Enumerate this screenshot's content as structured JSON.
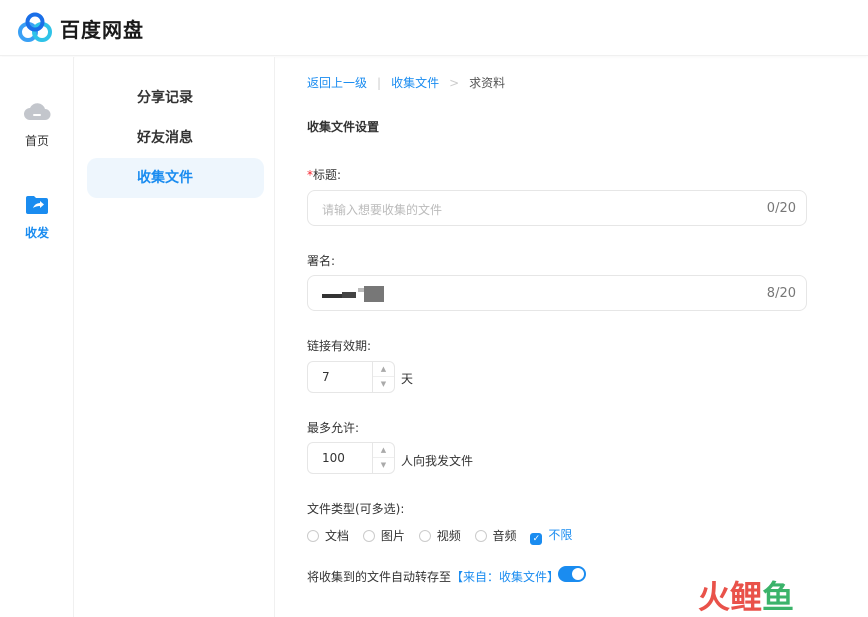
{
  "app": {
    "brand": "百度网盘"
  },
  "leftnav": {
    "home_label": "首页",
    "send_label": "收发"
  },
  "subnav": {
    "items": [
      {
        "label": "分享记录"
      },
      {
        "label": "好友消息"
      },
      {
        "label": "收集文件",
        "active": true
      }
    ]
  },
  "breadcrumb": {
    "back": "返回上一级",
    "sep1": "|",
    "parent": "收集文件",
    "sep2": ">",
    "current": "求资料"
  },
  "form": {
    "section_title": "收集文件设置",
    "title_field": {
      "required_mark": "*",
      "label": "标题:",
      "placeholder": "请输入想要收集的文件",
      "count": "0/20"
    },
    "signature_field": {
      "label": "署名:",
      "value": "",
      "count": "8/20"
    },
    "expiry": {
      "label": "链接有效期:",
      "value": "7",
      "unit": "天"
    },
    "max_allowed": {
      "label": "最多允许:",
      "value": "100",
      "unit": "人向我发文件"
    },
    "file_types": {
      "label": "文件类型(可多选):",
      "options": [
        {
          "label": "文档",
          "checked": false
        },
        {
          "label": "图片",
          "checked": false
        },
        {
          "label": "视频",
          "checked": false
        },
        {
          "label": "音频",
          "checked": false
        },
        {
          "label": "不限",
          "checked": true
        }
      ]
    },
    "autosave": {
      "text": "将收集到的文件自动转存至",
      "source": "【来自：收集文件】",
      "enabled": true
    }
  },
  "watermark": {
    "chars": [
      "火",
      "鲤",
      "鱼"
    ]
  },
  "colors": {
    "accent": "#1a8cf0",
    "required": "#f5222d",
    "active_bg": "#eef6fd"
  }
}
